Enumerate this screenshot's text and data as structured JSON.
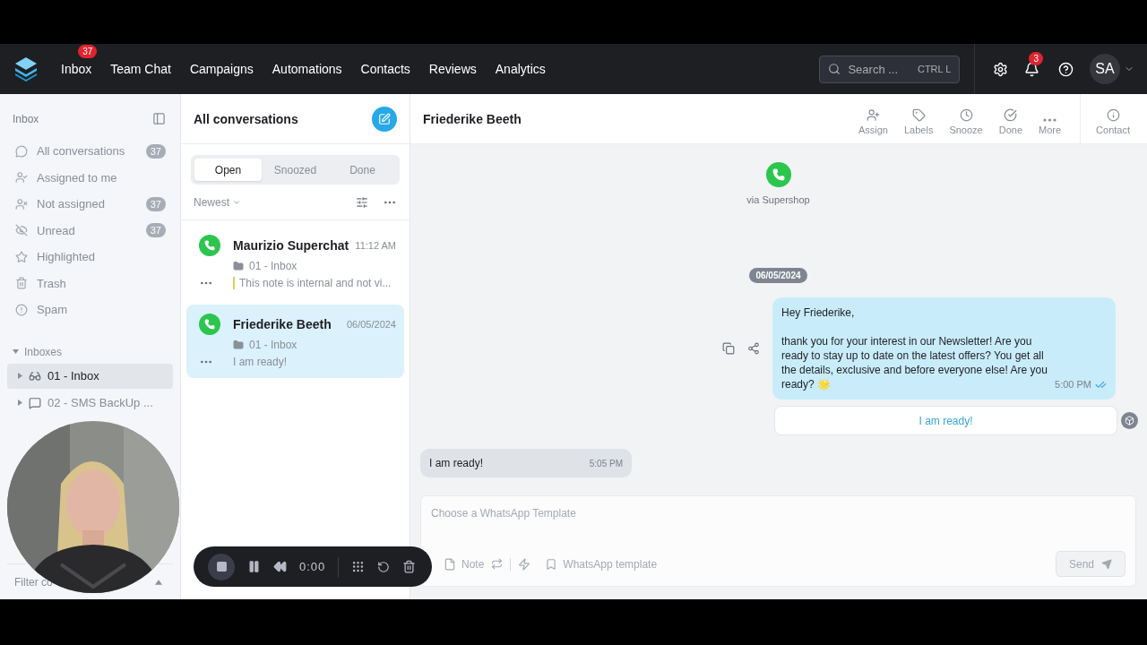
{
  "nav": {
    "items": [
      {
        "label": "Inbox",
        "badge": "37"
      },
      {
        "label": "Team Chat"
      },
      {
        "label": "Campaigns"
      },
      {
        "label": "Automations"
      },
      {
        "label": "Contacts"
      },
      {
        "label": "Reviews"
      },
      {
        "label": "Analytics"
      }
    ],
    "search": {
      "placeholder": "Search ...",
      "shortcut": "CTRL L"
    },
    "notifications_badge": "3",
    "avatar": "SA"
  },
  "sidebar": {
    "title": "Inbox",
    "items": [
      {
        "label": "All conversations",
        "count": "37"
      },
      {
        "label": "Assigned to me"
      },
      {
        "label": "Not assigned",
        "count": "37"
      },
      {
        "label": "Unread",
        "count": "37"
      },
      {
        "label": "Highlighted"
      },
      {
        "label": "Trash"
      },
      {
        "label": "Spam"
      }
    ],
    "inboxes_label": "Inboxes",
    "inboxes": [
      {
        "label": "01 - Inbox",
        "selected": true
      },
      {
        "label": "02 - SMS BackUp ...",
        "selected": false
      }
    ],
    "filter": "Filter co"
  },
  "conversations": {
    "title": "All conversations",
    "tabs": [
      {
        "label": "Open",
        "selected": true
      },
      {
        "label": "Snoozed",
        "selected": false
      },
      {
        "label": "Done",
        "selected": false
      }
    ],
    "sort": "Newest",
    "items": [
      {
        "name": "Maurizio Superchat",
        "time": "11:12 AM",
        "inbox": "01 - Inbox",
        "preview": "This note is internal and not vi...",
        "kind": "note",
        "selected": false
      },
      {
        "name": "Friederike Beeth",
        "time": "06/05/2024",
        "inbox": "01 - Inbox",
        "preview": "I am ready!",
        "kind": "message",
        "selected": true
      }
    ]
  },
  "chat": {
    "title": "Friederike Beeth",
    "actions": [
      "Assign",
      "Labels",
      "Snooze",
      "Done",
      "More"
    ],
    "contact": "Contact",
    "channel": "via Supershop",
    "date": "06/05/2024",
    "outgoing": {
      "text": "Hey Friederike,\n\nthank you for your interest in our Newsletter! Are you ready to stay up to date on the latest offers? You get all the details, exclusive and before everyone else! Are you ready? 🌟",
      "time": "5:00 PM",
      "read": true,
      "reply_button": "I am ready!"
    },
    "incoming": {
      "text": "I am ready!",
      "time": "5:05 PM"
    },
    "composer": {
      "placeholder": "Choose a WhatsApp Template",
      "note": "Note",
      "template": "WhatsApp template",
      "send": "Send"
    }
  },
  "recorder": {
    "time": "0:00"
  }
}
